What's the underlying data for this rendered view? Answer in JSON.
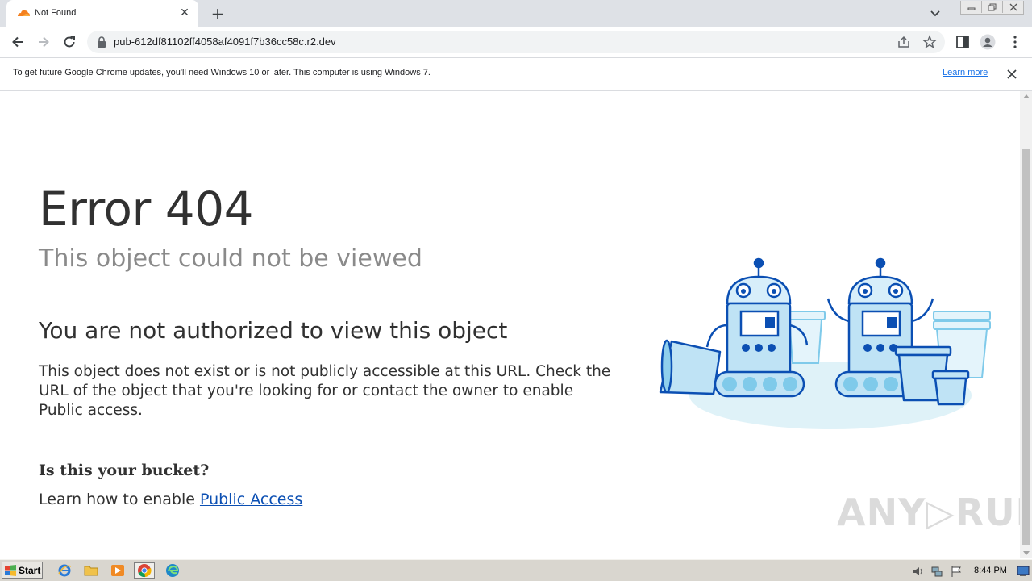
{
  "browser": {
    "tab": {
      "title": "Not Found",
      "favicon": "cloudflare-icon"
    },
    "address": {
      "url": "pub-612df81102ff4058af4091f7b36cc58c.r2.dev"
    },
    "infobar": {
      "message": "To get future Google Chrome updates, you'll need Windows 10 or later. This computer is using Windows 7.",
      "link": "Learn more"
    },
    "accent": "#1a73e8"
  },
  "page": {
    "error_title": "Error 404",
    "error_subtitle": "This object could not be viewed",
    "heading": "You are not authorized to view this object",
    "description": "This object does not exist or is not publicly accessible at this URL. Check the URL of the object that you're looking for or contact the owner to enable Public access.",
    "bucket_heading": "Is this your bucket?",
    "learn_prefix": "Learn how to enable ",
    "learn_link": "Public Access",
    "watermark": "ANY▷RUN"
  },
  "taskbar": {
    "start_label": "Start",
    "apps": [
      "internet-explorer-icon",
      "folder-icon",
      "media-player-icon",
      "chrome-icon",
      "edge-icon"
    ],
    "clock": "8:44 PM"
  }
}
